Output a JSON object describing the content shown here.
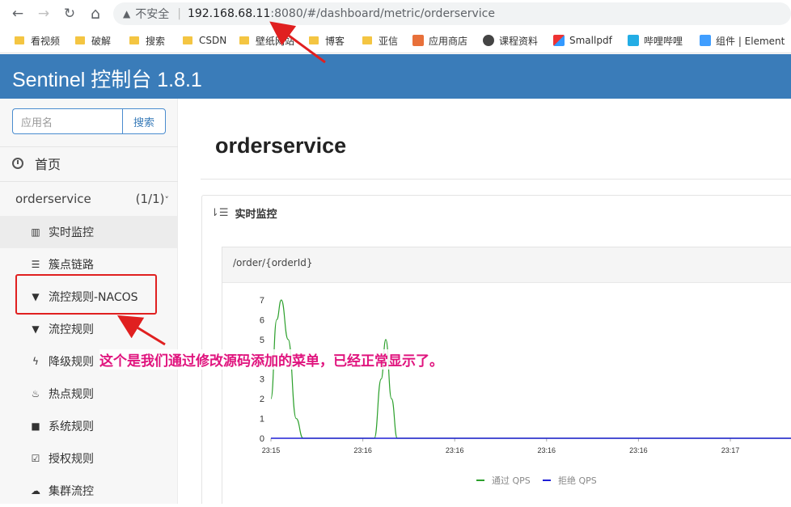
{
  "browser": {
    "nav": {
      "back": "←",
      "forward": "→",
      "reload": "↻",
      "home": "⌂"
    },
    "security_label": "不安全",
    "url_host": "192.168.68.11",
    "url_path": ":8080/#/dashboard/metric/orderservice",
    "bookmarks": [
      {
        "label": "看视频",
        "icon": "folder-icon"
      },
      {
        "label": "破解",
        "icon": "folder-icon"
      },
      {
        "label": "搜索",
        "icon": "folder-icon"
      },
      {
        "label": "CSDN",
        "icon": "folder-icon"
      },
      {
        "label": "壁纸网站",
        "icon": "folder-icon"
      },
      {
        "label": "博客",
        "icon": "folder-icon"
      },
      {
        "label": "亚信",
        "icon": "folder-icon"
      },
      {
        "label": "应用商店",
        "icon": "store-icon"
      },
      {
        "label": "课程资料",
        "icon": "globe-icon"
      },
      {
        "label": "Smallpdf",
        "icon": "smallpdf-icon"
      },
      {
        "label": "哔哩哔哩",
        "icon": "bilibili-icon"
      },
      {
        "label": "组件 | Element",
        "icon": "element-icon"
      }
    ]
  },
  "app": {
    "title": "Sentinel 控制台 1.8.1"
  },
  "sidebar": {
    "search_placeholder": "应用名",
    "search_button": "搜索",
    "home_label": "首页",
    "app_name": "orderservice",
    "app_count": "(1/1)",
    "menu": [
      {
        "label": "实时监控",
        "icon": "bar-chart-icon",
        "glyph": "▥"
      },
      {
        "label": "簇点链路",
        "icon": "list-icon",
        "glyph": "☰"
      },
      {
        "label": "流控规则-NACOS",
        "icon": "filter-icon",
        "glyph": "▼"
      },
      {
        "label": "流控规则",
        "icon": "filter-icon",
        "glyph": "▼"
      },
      {
        "label": "降级规则",
        "icon": "flash-icon",
        "glyph": "ϟ"
      },
      {
        "label": "热点规则",
        "icon": "fire-icon",
        "glyph": "♨"
      },
      {
        "label": "系统规则",
        "icon": "lock-icon",
        "glyph": "■"
      },
      {
        "label": "授权规则",
        "icon": "check-icon",
        "glyph": "☑"
      },
      {
        "label": "集群流控",
        "icon": "cloud-icon",
        "glyph": "☁"
      }
    ]
  },
  "main": {
    "page_title": "orderservice",
    "panel_title": "实时监控",
    "resource": "/order/{orderId}"
  },
  "annotation": {
    "text": "这个是我们通过修改源码添加的菜单，已经正常显示了。"
  },
  "colors": {
    "header": "#3a7cb9",
    "pass": "#2ca02c",
    "reject": "#1f1fd6",
    "annotation": "#e0147e",
    "highlight": "#e02020"
  },
  "chart_data": {
    "type": "line",
    "y_ticks": [
      0,
      1,
      2,
      3,
      4,
      5,
      6,
      7
    ],
    "ylim": [
      0,
      7
    ],
    "x_tick_labels": [
      "23:15",
      "23:16",
      "23:16",
      "23:16",
      "23:16",
      "23:17"
    ],
    "series": [
      {
        "name": "通过 QPS",
        "color": "#2ca02c",
        "points": [
          [
            0,
            2
          ],
          [
            0.25,
            6
          ],
          [
            0.45,
            7
          ],
          [
            0.75,
            5
          ],
          [
            1.1,
            1
          ],
          [
            1.4,
            0
          ],
          [
            4.5,
            0
          ],
          [
            4.8,
            3
          ],
          [
            5.0,
            5
          ],
          [
            5.25,
            2
          ],
          [
            5.5,
            0
          ],
          [
            23,
            0
          ]
        ]
      },
      {
        "name": "拒绝 QPS",
        "color": "#1f1fd6",
        "points": [
          [
            0,
            0
          ],
          [
            23,
            0
          ]
        ]
      }
    ],
    "x_units_per_tick": 4
  }
}
